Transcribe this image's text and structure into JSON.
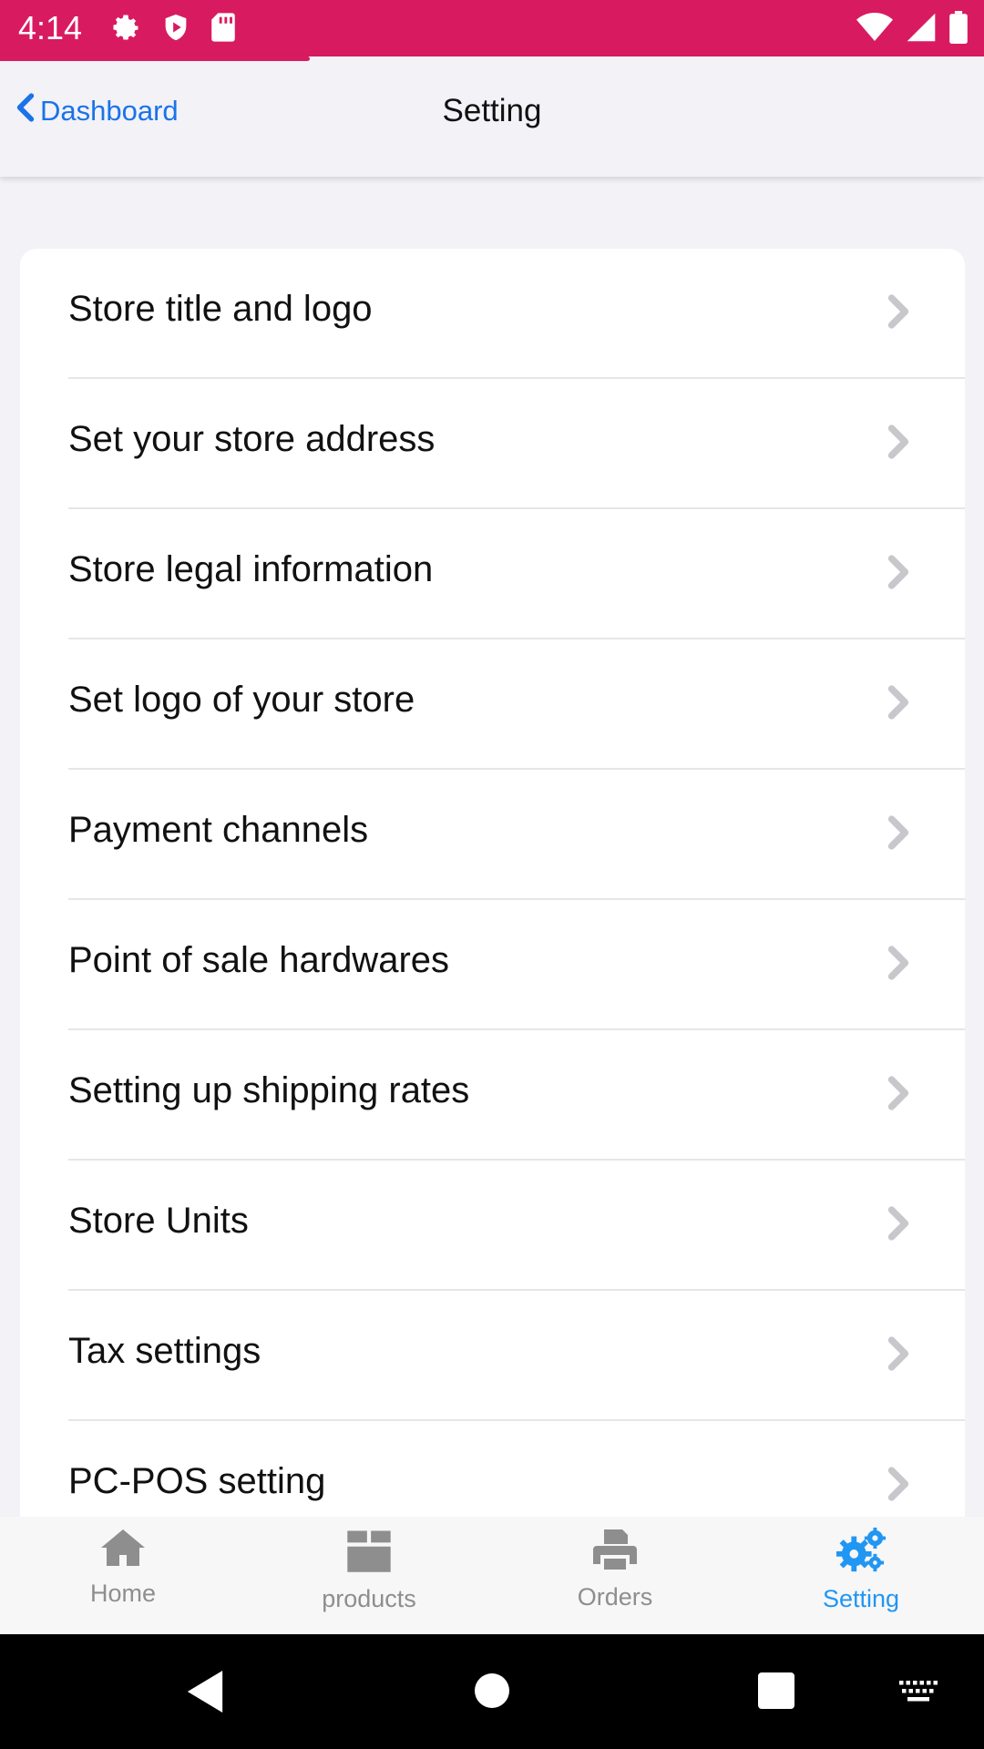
{
  "status": {
    "time": "4:14"
  },
  "header": {
    "back_label": "Dashboard",
    "title": "Setting"
  },
  "settings_items": [
    {
      "label": "Store title and logo"
    },
    {
      "label": "Set your store address"
    },
    {
      "label": "Store legal information"
    },
    {
      "label": "Set logo of your store"
    },
    {
      "label": "Payment channels"
    },
    {
      "label": "Point of sale hardwares"
    },
    {
      "label": "Setting up shipping rates"
    },
    {
      "label": "Store Units"
    },
    {
      "label": "Tax settings"
    },
    {
      "label": "PC-POS setting"
    }
  ],
  "tabs": [
    {
      "label": "Home",
      "icon": "home-icon"
    },
    {
      "label": "products",
      "icon": "box-icon"
    },
    {
      "label": "Orders",
      "icon": "printer-icon"
    },
    {
      "label": "Setting",
      "icon": "gears-icon",
      "active": true
    }
  ],
  "colors": {
    "status_bar": "#d81b60",
    "accent": "#2196f3",
    "link": "#1a73e8"
  }
}
